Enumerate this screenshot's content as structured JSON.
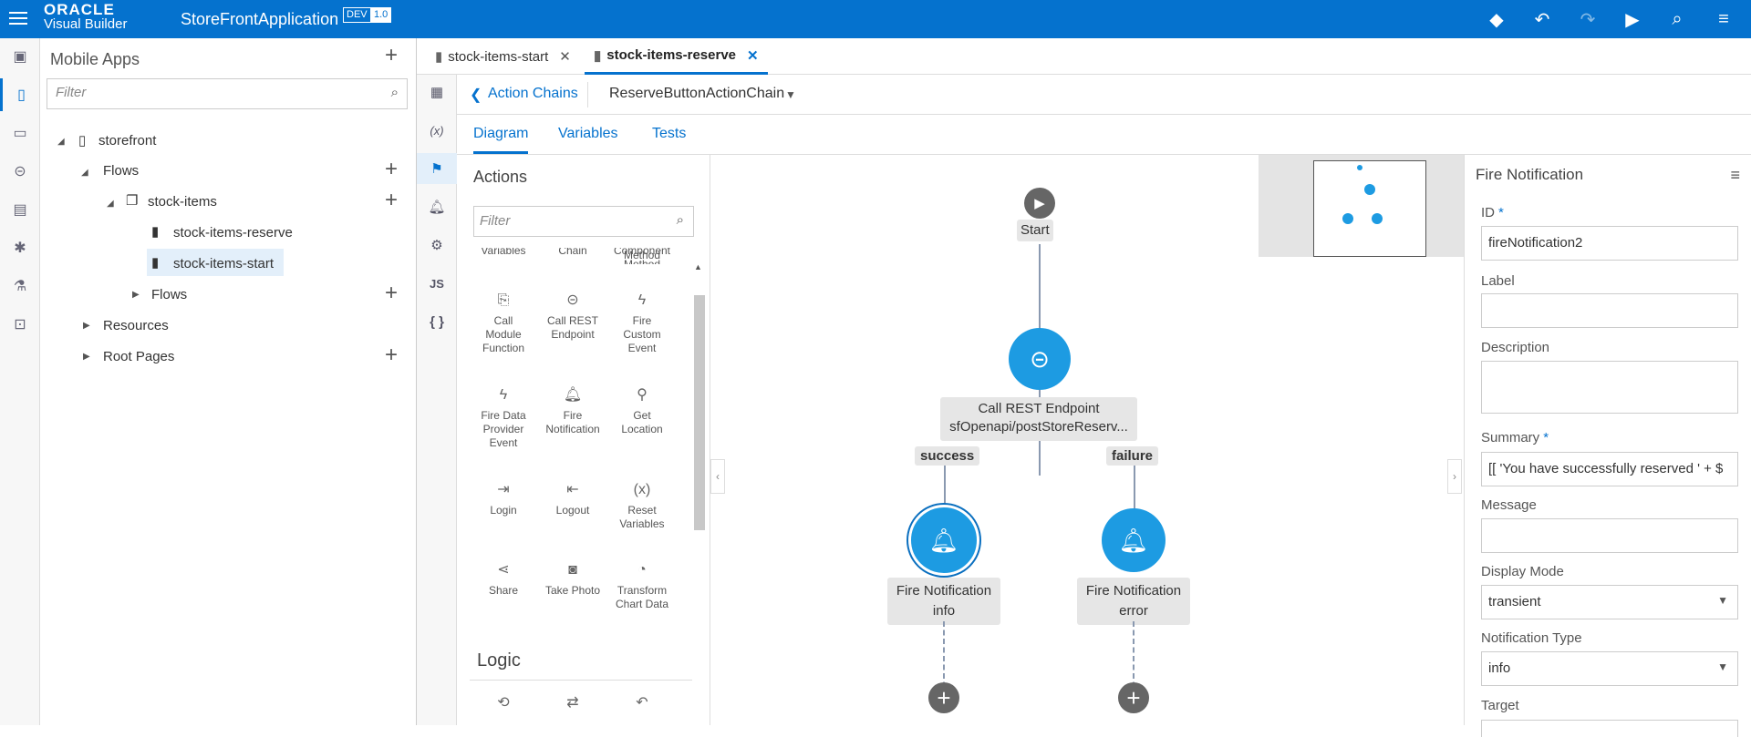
{
  "header": {
    "logo_line1": "ORACLE",
    "logo_line2": "Visual Builder",
    "app_name": "StoreFrontApplication",
    "env_badge": "DEV",
    "version_badge": "1.0"
  },
  "nav": {
    "title": "Mobile Apps",
    "filter_placeholder": "Filter",
    "tree": [
      {
        "label": "storefront"
      },
      {
        "label": "Flows"
      },
      {
        "label": "stock-items"
      },
      {
        "label": "stock-items-reserve"
      },
      {
        "label": "stock-items-start"
      },
      {
        "label": "Flows"
      },
      {
        "label": "Resources"
      },
      {
        "label": "Root Pages"
      }
    ]
  },
  "editor_tabs": [
    {
      "label": "stock-items-start"
    },
    {
      "label": "stock-items-reserve"
    }
  ],
  "crumbs": {
    "back_label": "Action Chains",
    "chain_name": "ReserveButtonActionChain"
  },
  "subtabs": [
    "Diagram",
    "Variables",
    "Tests"
  ],
  "palette": {
    "title": "Actions",
    "filter_placeholder": "Filter",
    "partial_top": [
      "Variables",
      "Chain",
      "Component\nMethod"
    ],
    "items": [
      {
        "label": "Call\nModule\nFunction",
        "icon": "module-icon"
      },
      {
        "label": "Call REST\nEndpoint",
        "icon": "rest-icon"
      },
      {
        "label": "Fire\nCustom\nEvent",
        "icon": "bolt-icon"
      },
      {
        "label": "Fire Data\nProvider\nEvent",
        "icon": "bolt-icon"
      },
      {
        "label": "Fire\nNotification",
        "icon": "bell-icon"
      },
      {
        "label": "Get\nLocation",
        "icon": "location-icon"
      },
      {
        "label": "Login",
        "icon": "login-icon"
      },
      {
        "label": "Logout",
        "icon": "logout-icon"
      },
      {
        "label": "Reset\nVariables",
        "icon": "reset-icon"
      },
      {
        "label": "Share",
        "icon": "share-icon"
      },
      {
        "label": "Take Photo",
        "icon": "camera-icon"
      },
      {
        "label": "Transform\nChart Data",
        "icon": "pie-icon"
      }
    ],
    "logic_title": "Logic"
  },
  "diagram": {
    "start_label": "Start",
    "rest_line1": "Call REST Endpoint",
    "rest_line2": "sfOpenapi/postStoreReserv...",
    "success_label": "success",
    "failure_label": "failure",
    "notify1_line1": "Fire Notification",
    "notify1_line2": "info",
    "notify2_line1": "Fire Notification",
    "notify2_line2": "error"
  },
  "props": {
    "title": "Fire Notification",
    "id_label": "ID",
    "id_value": "fireNotification2",
    "label_label": "Label",
    "label_value": "",
    "description_label": "Description",
    "description_value": "",
    "summary_label": "Summary",
    "summary_value": "[[ 'You have successfully reserved ' + $",
    "message_label": "Message",
    "message_value": "",
    "display_mode_label": "Display Mode",
    "display_mode_value": "transient",
    "notification_type_label": "Notification Type",
    "notification_type_value": "info",
    "target_label": "Target"
  },
  "colors": {
    "brand": "#0572ce",
    "node": "#1d9be2"
  }
}
